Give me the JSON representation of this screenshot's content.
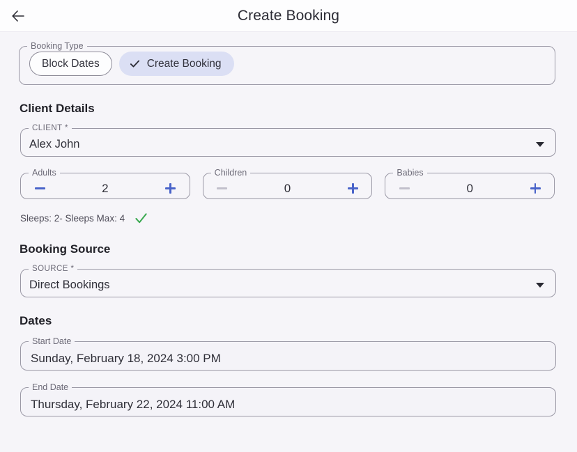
{
  "appbar": {
    "back_icon": "arrow-left-icon",
    "title": "Create Booking"
  },
  "booking_type": {
    "legend": "Booking Type",
    "options": [
      {
        "label": "Block Dates",
        "selected": false
      },
      {
        "label": "Create Booking",
        "selected": true,
        "icon": "check-icon"
      }
    ]
  },
  "client_details": {
    "heading": "Client Details",
    "client": {
      "legend": "CLIENT *",
      "value": "Alex John",
      "caret_icon": "chevron-down-icon"
    },
    "occupancy": [
      {
        "legend": "Adults",
        "value": "2",
        "minus_disabled": false,
        "plus_disabled": false
      },
      {
        "legend": "Children",
        "value": "0",
        "minus_disabled": true,
        "plus_disabled": false
      },
      {
        "legend": "Babies",
        "value": "0",
        "minus_disabled": true,
        "plus_disabled": false
      }
    ],
    "sleeps_text": "Sleeps: 2- Sleeps Max: 4",
    "sleeps_icon": "check-valid-icon"
  },
  "booking_source": {
    "heading": "Booking Source",
    "source": {
      "legend": "SOURCE *",
      "value": "Direct Bookings",
      "caret_icon": "chevron-down-icon"
    }
  },
  "dates": {
    "heading": "Dates",
    "start": {
      "legend": "Start Date",
      "value": "Sunday, February 18, 2024 3:00 PM"
    },
    "end": {
      "legend": "End Date",
      "value": "Thursday, February 22, 2024 11:00 AM"
    }
  },
  "colors": {
    "page_bg": "#f6f5f9",
    "appbar_bg": "#fdfdfe",
    "chip_selected_bg": "#dbdff4",
    "accent_blue": "#4963c9",
    "valid_green": "#3aa950",
    "border": "#9a98a5"
  }
}
